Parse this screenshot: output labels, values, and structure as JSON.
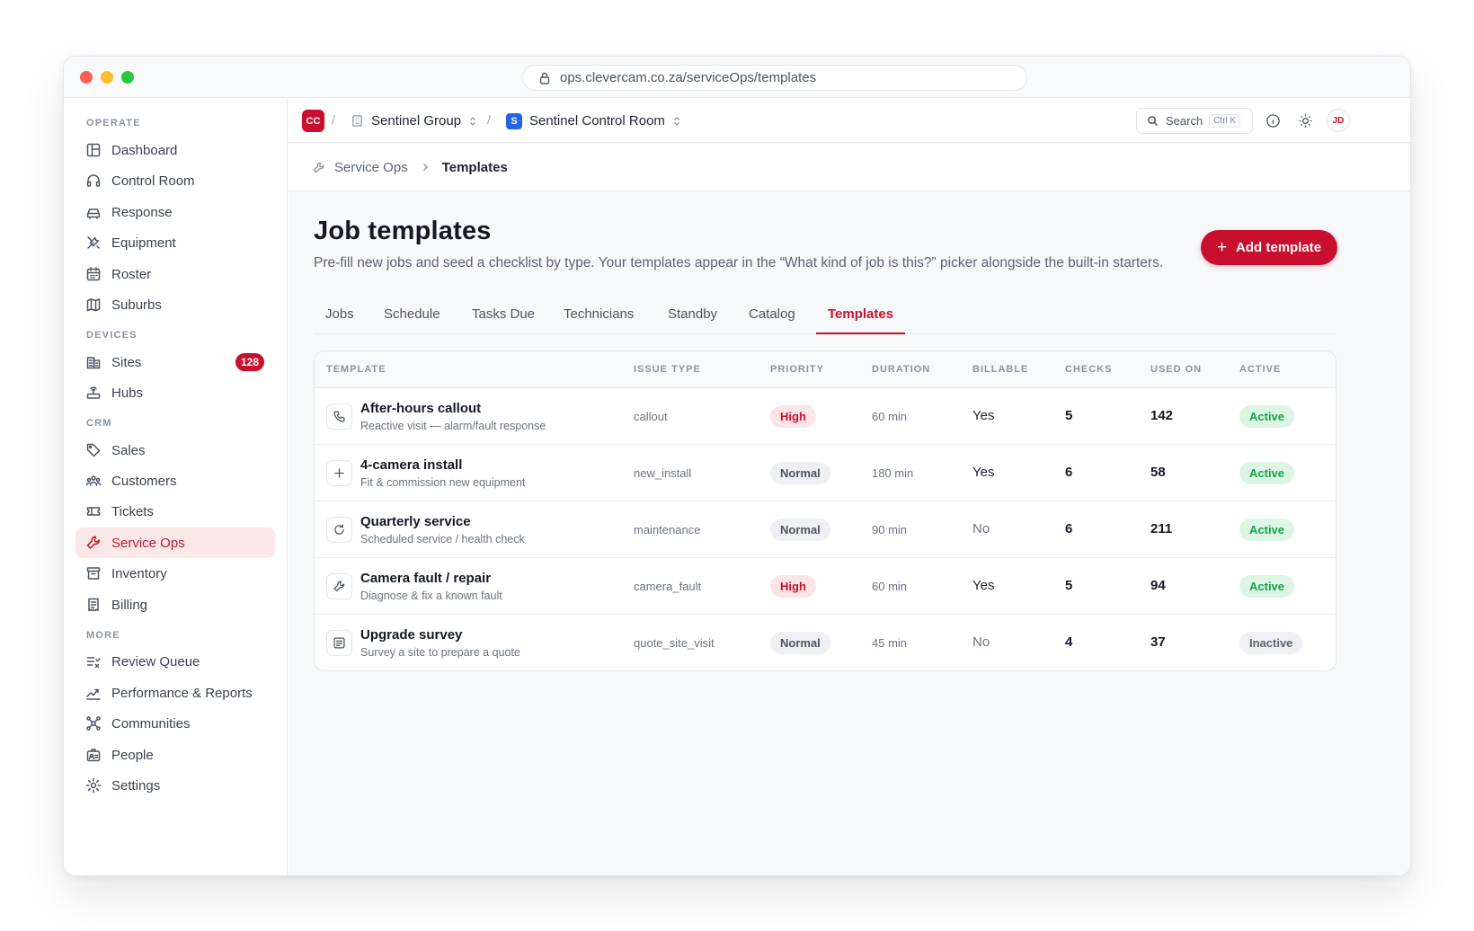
{
  "browser": {
    "url": "ops.clevercam.co.za/serviceOps/templates"
  },
  "sidebar": {
    "sections": [
      {
        "label": "OPERATE",
        "items": [
          {
            "label": "Dashboard",
            "icon": "layout-icon"
          },
          {
            "label": "Control Room",
            "icon": "headset-icon"
          },
          {
            "label": "Response",
            "icon": "car-icon"
          },
          {
            "label": "Equipment",
            "icon": "tools-icon"
          },
          {
            "label": "Roster",
            "icon": "calendar-icon"
          },
          {
            "label": "Suburbs",
            "icon": "map-icon"
          }
        ]
      },
      {
        "label": "DEVICES",
        "items": [
          {
            "label": "Sites",
            "icon": "building-icon",
            "badge": "128"
          },
          {
            "label": "Hubs",
            "icon": "router-icon"
          }
        ]
      },
      {
        "label": "CRM",
        "items": [
          {
            "label": "Sales",
            "icon": "tag-icon"
          },
          {
            "label": "Customers",
            "icon": "users-icon"
          },
          {
            "label": "Tickets",
            "icon": "ticket-icon"
          },
          {
            "label": "Service Ops",
            "icon": "wrench-icon",
            "active": true
          },
          {
            "label": "Inventory",
            "icon": "archive-icon"
          },
          {
            "label": "Billing",
            "icon": "receipt-icon"
          }
        ]
      },
      {
        "label": "MORE",
        "items": [
          {
            "label": "Review Queue",
            "icon": "list-check-icon"
          },
          {
            "label": "Performance & Reports",
            "icon": "trend-icon"
          },
          {
            "label": "Communities",
            "icon": "network-icon"
          },
          {
            "label": "People",
            "icon": "id-badge-icon"
          },
          {
            "label": "Settings",
            "icon": "gear-icon"
          }
        ]
      }
    ]
  },
  "topbar": {
    "org_logo": "CC",
    "org_name": "Sentinel Group",
    "room_badge": "S",
    "room_name": "Sentinel Control Room",
    "search_label": "Search",
    "search_shortcut": "Ctrl K",
    "avatar_initials": "JD"
  },
  "breadcrumb": {
    "parent": "Service Ops",
    "current": "Templates"
  },
  "page": {
    "title": "Job templates",
    "subtitle": "Pre-fill new jobs and seed a checklist by type. Your templates appear in the “What kind of job is this?” picker alongside the built-in starters.",
    "add_button": "Add template"
  },
  "tabs": [
    "Jobs",
    "Schedule",
    "Tasks Due",
    "Technicians",
    "Standby",
    "Catalog",
    "Templates"
  ],
  "active_tab": "Templates",
  "table": {
    "headers": [
      "TEMPLATE",
      "ISSUE TYPE",
      "PRIORITY",
      "DURATION",
      "BILLABLE",
      "CHECKS",
      "USED ON",
      "ACTIVE"
    ],
    "rows": [
      {
        "icon": "phone-icon",
        "name": "After-hours callout",
        "desc": "Reactive visit — alarm/fault response",
        "issue_type": "callout",
        "priority": "High",
        "duration": "60 min",
        "billable": "Yes",
        "checks": "5",
        "used_on": "142",
        "active": "Active"
      },
      {
        "icon": "plus-icon",
        "name": "4-camera install",
        "desc": "Fit & commission new equipment",
        "issue_type": "new_install",
        "priority": "Normal",
        "duration": "180 min",
        "billable": "Yes",
        "checks": "6",
        "used_on": "58",
        "active": "Active"
      },
      {
        "icon": "refresh-icon",
        "name": "Quarterly service",
        "desc": "Scheduled service / health check",
        "issue_type": "maintenance",
        "priority": "Normal",
        "duration": "90 min",
        "billable": "No",
        "checks": "6",
        "used_on": "211",
        "active": "Active"
      },
      {
        "icon": "wrench-icon",
        "name": "Camera fault / repair",
        "desc": "Diagnose & fix a known fault",
        "issue_type": "camera_fault",
        "priority": "High",
        "duration": "60 min",
        "billable": "Yes",
        "checks": "5",
        "used_on": "94",
        "active": "Active"
      },
      {
        "icon": "note-icon",
        "name": "Upgrade survey",
        "desc": "Survey a site to prepare a quote",
        "issue_type": "quote_site_visit",
        "priority": "Normal",
        "duration": "45 min",
        "billable": "No",
        "checks": "4",
        "used_on": "37",
        "active": "Inactive"
      }
    ]
  },
  "colors": {
    "accent": "#c8102e",
    "room_badge": "#2563eb",
    "active_green": "#16a34a"
  }
}
